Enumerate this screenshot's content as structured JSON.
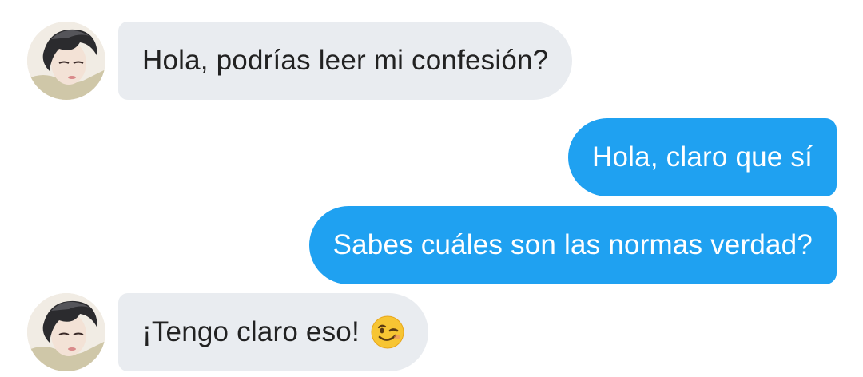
{
  "messages": [
    {
      "id": 1,
      "direction": "incoming",
      "text": "Hola, podrías leer mi confesión?",
      "avatar": "user-avatar"
    },
    {
      "id": 2,
      "direction": "outgoing",
      "text": "Hola, claro que sí"
    },
    {
      "id": 3,
      "direction": "outgoing",
      "text": "Sabes cuáles son las normas verdad?"
    },
    {
      "id": 4,
      "direction": "incoming",
      "text": "¡Tengo claro eso!",
      "emoji": "winking-face-icon",
      "avatar": "user-avatar"
    }
  ],
  "colors": {
    "incoming_bubble": "#e9ecf0",
    "outgoing_bubble": "#1fa1f1",
    "incoming_text": "#222222",
    "outgoing_text": "#ffffff"
  }
}
